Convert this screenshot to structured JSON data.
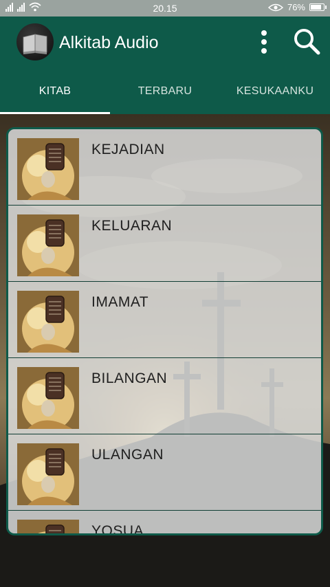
{
  "status_bar": {
    "time": "20.15",
    "battery": "76%",
    "battery_level": 0.76
  },
  "app": {
    "title": "Alkitab Audio",
    "icons": {
      "logo": "bible-book-icon",
      "menu": "more-vertical-icon",
      "search": "search-icon"
    }
  },
  "tabs": [
    {
      "label": "KITAB",
      "active": true
    },
    {
      "label": "TERBARU",
      "active": false
    },
    {
      "label": "KESUKAANKU",
      "active": false
    }
  ],
  "books": [
    {
      "label": "KEJADIAN"
    },
    {
      "label": "KELUARAN"
    },
    {
      "label": "IMAMAT"
    },
    {
      "label": "BILANGAN"
    },
    {
      "label": "ULANGAN"
    },
    {
      "label": "YOSUA"
    }
  ],
  "colors": {
    "primary": "#0e5a49",
    "status_bar": "#9aa39f"
  }
}
